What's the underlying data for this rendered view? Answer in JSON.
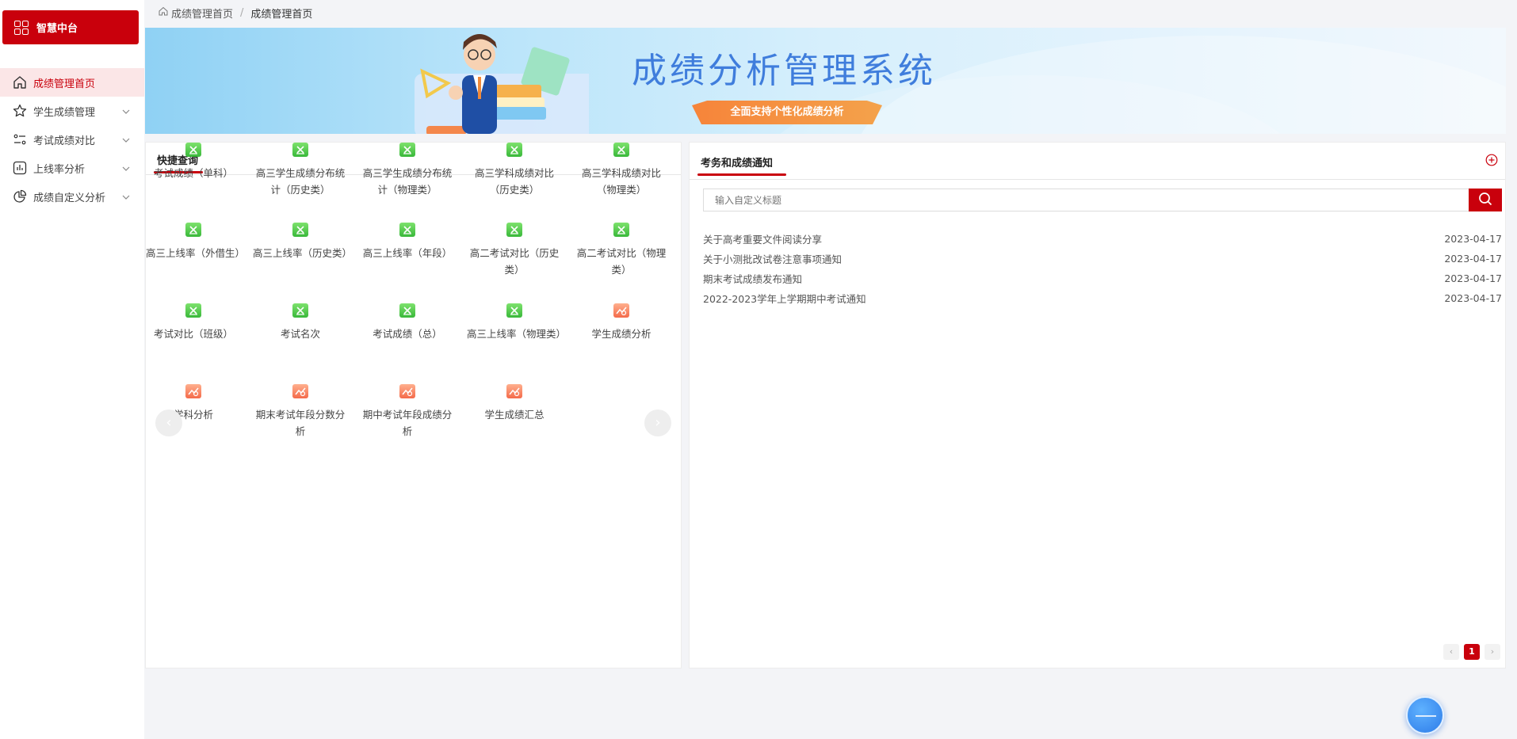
{
  "sidebar": {
    "brand": "智慧中台",
    "items": [
      {
        "label": "成绩管理首页",
        "icon": "home-icon",
        "active": true
      },
      {
        "label": "学生成绩管理",
        "icon": "star-icon",
        "expandable": true
      },
      {
        "label": "考试成绩对比",
        "icon": "compare-icon",
        "expandable": true
      },
      {
        "label": "上线率分析",
        "icon": "bar-chart-icon",
        "expandable": true
      },
      {
        "label": "成绩自定义分析",
        "icon": "pie-chart-icon",
        "expandable": true
      }
    ]
  },
  "breadcrumb": [
    "成绩管理首页",
    "成绩管理首页"
  ],
  "banner": {
    "title": "成绩分析管理系统",
    "subtitle": "全面支持个性化成绩分析"
  },
  "quick": {
    "title": "快捷查询",
    "items": [
      {
        "label": "考试成绩（单科）",
        "icon": "spreadsheet-icon",
        "color": "green"
      },
      {
        "label": "高三学生成绩分布统计（历史类）",
        "icon": "spreadsheet-icon",
        "color": "green"
      },
      {
        "label": "高三学生成绩分布统计（物理类）",
        "icon": "spreadsheet-icon",
        "color": "green"
      },
      {
        "label": "高三学科成绩对比（历史类）",
        "icon": "spreadsheet-icon",
        "color": "green"
      },
      {
        "label": "高三学科成绩对比（物理类）",
        "icon": "spreadsheet-icon",
        "color": "green"
      },
      {
        "label": "高三上线率（外借生）",
        "icon": "spreadsheet-icon",
        "color": "green"
      },
      {
        "label": "高三上线率（历史类）",
        "icon": "spreadsheet-icon",
        "color": "green"
      },
      {
        "label": "高三上线率（年段）",
        "icon": "spreadsheet-icon",
        "color": "green"
      },
      {
        "label": "高二考试对比（历史类）",
        "icon": "spreadsheet-icon",
        "color": "green"
      },
      {
        "label": "高二考试对比（物理类）",
        "icon": "spreadsheet-icon",
        "color": "green"
      },
      {
        "label": "考试对比（班级）",
        "icon": "spreadsheet-icon",
        "color": "green"
      },
      {
        "label": "考试名次",
        "icon": "spreadsheet-icon",
        "color": "green"
      },
      {
        "label": "考试成绩（总）",
        "icon": "spreadsheet-icon",
        "color": "green"
      },
      {
        "label": "高三上线率（物理类）",
        "icon": "spreadsheet-icon",
        "color": "green"
      },
      {
        "label": "学生成绩分析",
        "icon": "analysis-icon",
        "color": "orange"
      },
      {
        "label": "学科分析",
        "icon": "analysis-icon",
        "color": "orange"
      },
      {
        "label": "期末考试年段分数分析",
        "icon": "analysis-icon",
        "color": "orange"
      },
      {
        "label": "期中考试年段成绩分析",
        "icon": "analysis-icon",
        "color": "orange"
      },
      {
        "label": "学生成绩汇总",
        "icon": "analysis-icon",
        "color": "orange"
      }
    ]
  },
  "notices": {
    "title": "考务和成绩通知",
    "search_placeholder": "输入自定义标题",
    "items": [
      {
        "title": "关于高考重要文件阅读分享",
        "date": "2023-04-17"
      },
      {
        "title": "关于小测批改试卷注意事项通知",
        "date": "2023-04-17"
      },
      {
        "title": "期末考试成绩发布通知",
        "date": "2023-04-17"
      },
      {
        "title": "2022-2023学年上学期期中考试通知",
        "date": "2023-04-17"
      }
    ],
    "pager": {
      "current": "1"
    }
  },
  "colors": {
    "accent": "#c9000c",
    "banner_title": "#3f7ddc"
  }
}
